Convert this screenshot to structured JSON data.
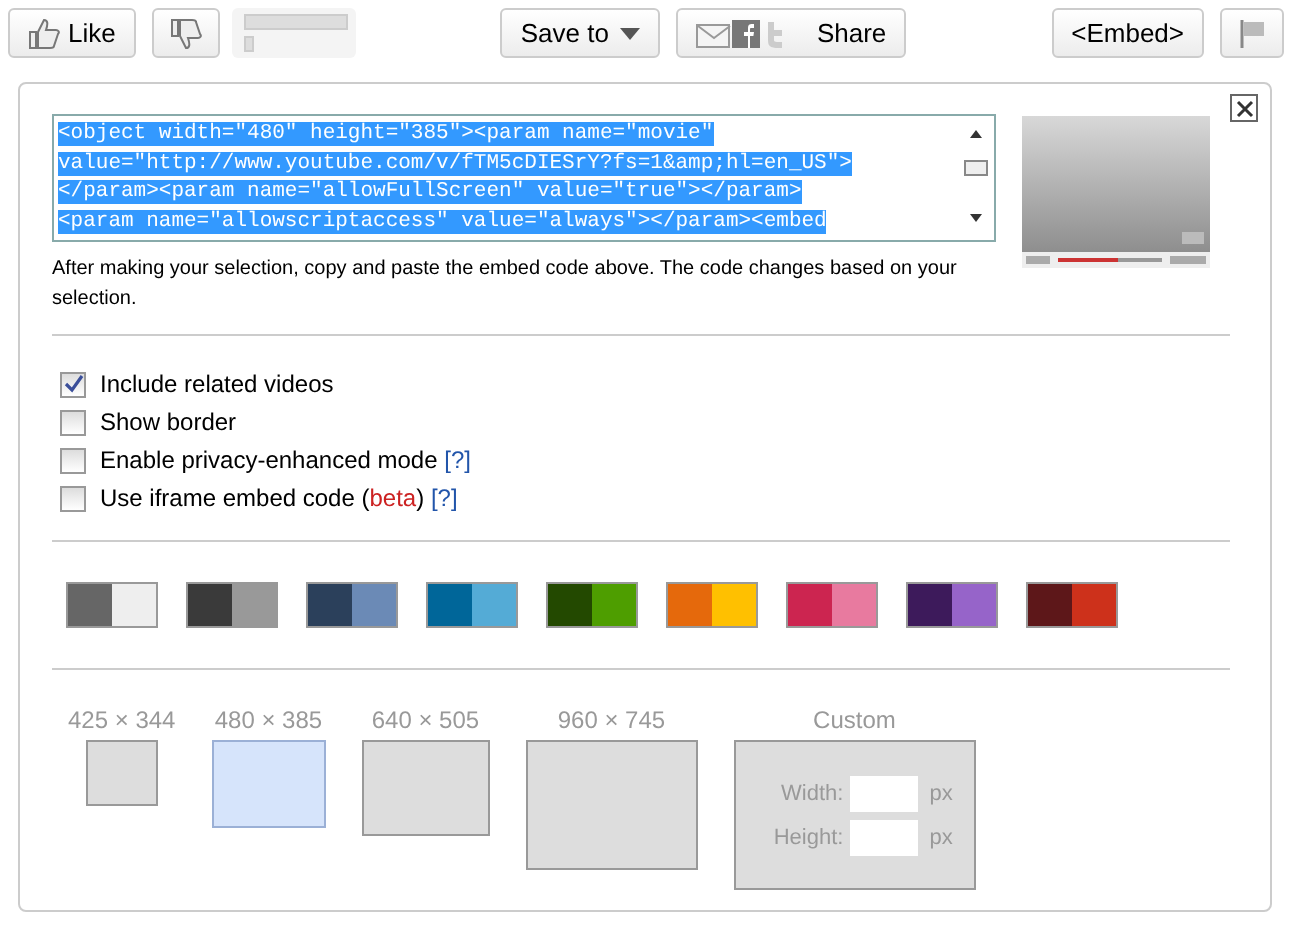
{
  "toolbar": {
    "like": "Like",
    "save": "Save to",
    "share": "Share",
    "embed": "<Embed>"
  },
  "embed_code": {
    "lines": [
      "<object width=\"480\" height=\"385\"><param name=\"movie\"",
      "value=\"http://www.youtube.com/v/fTM5cDIESrY?fs=1&amp;hl=en_US\">",
      "</param><param name=\"allowFullScreen\" value=\"true\"></param>",
      "<param name=\"allowscriptaccess\" value=\"always\"></param><embed"
    ],
    "selected": true
  },
  "hint": "After making your selection, copy and paste the embed code above. The code changes based on your selection.",
  "options": [
    {
      "label": "Include related videos",
      "checked": true
    },
    {
      "label": "Show border",
      "checked": false
    },
    {
      "label": "Enable privacy-enhanced mode",
      "help": "[?]",
      "checked": false
    },
    {
      "label": "Use iframe embed code",
      "note_open": "(",
      "note": "beta",
      "note_close": ")",
      "help": "[?]",
      "checked": false
    }
  ],
  "swatches": [
    {
      "halves": [
        {
          "color": "#666666"
        },
        {
          "color": "#eeeeee"
        }
      ]
    },
    {
      "halves": [
        {
          "color": "#3a3a3a"
        },
        {
          "color": "#999999"
        }
      ]
    },
    {
      "halves": [
        {
          "color": "#2b405b"
        },
        {
          "color": "#6b8ab6"
        }
      ]
    },
    {
      "halves": [
        {
          "color": "#006699"
        },
        {
          "color": "#54abd6"
        }
      ]
    },
    {
      "halves": [
        {
          "color": "#234900"
        },
        {
          "color": "#4e9e00"
        }
      ]
    },
    {
      "halves": [
        {
          "color": "#e5690c"
        },
        {
          "color": "#ffc000"
        }
      ]
    },
    {
      "halves": [
        {
          "color": "#cc2550"
        },
        {
          "color": "#e87a9f"
        }
      ]
    },
    {
      "halves": [
        {
          "color": "#3d1a5b"
        },
        {
          "color": "#9664c9"
        }
      ]
    },
    {
      "halves": [
        {
          "color": "#5d1719"
        },
        {
          "color": "#cd311b"
        }
      ]
    }
  ],
  "sizes": [
    {
      "label": "425 × 344",
      "selected": false
    },
    {
      "label": "480 × 385",
      "selected": true
    },
    {
      "label": "640 × 505",
      "selected": false
    },
    {
      "label": "960 × 745",
      "selected": false
    }
  ],
  "custom": {
    "title": "Custom",
    "width_label": "Width:",
    "height_label": "Height:",
    "width_unit": "px",
    "height_unit": "px"
  }
}
